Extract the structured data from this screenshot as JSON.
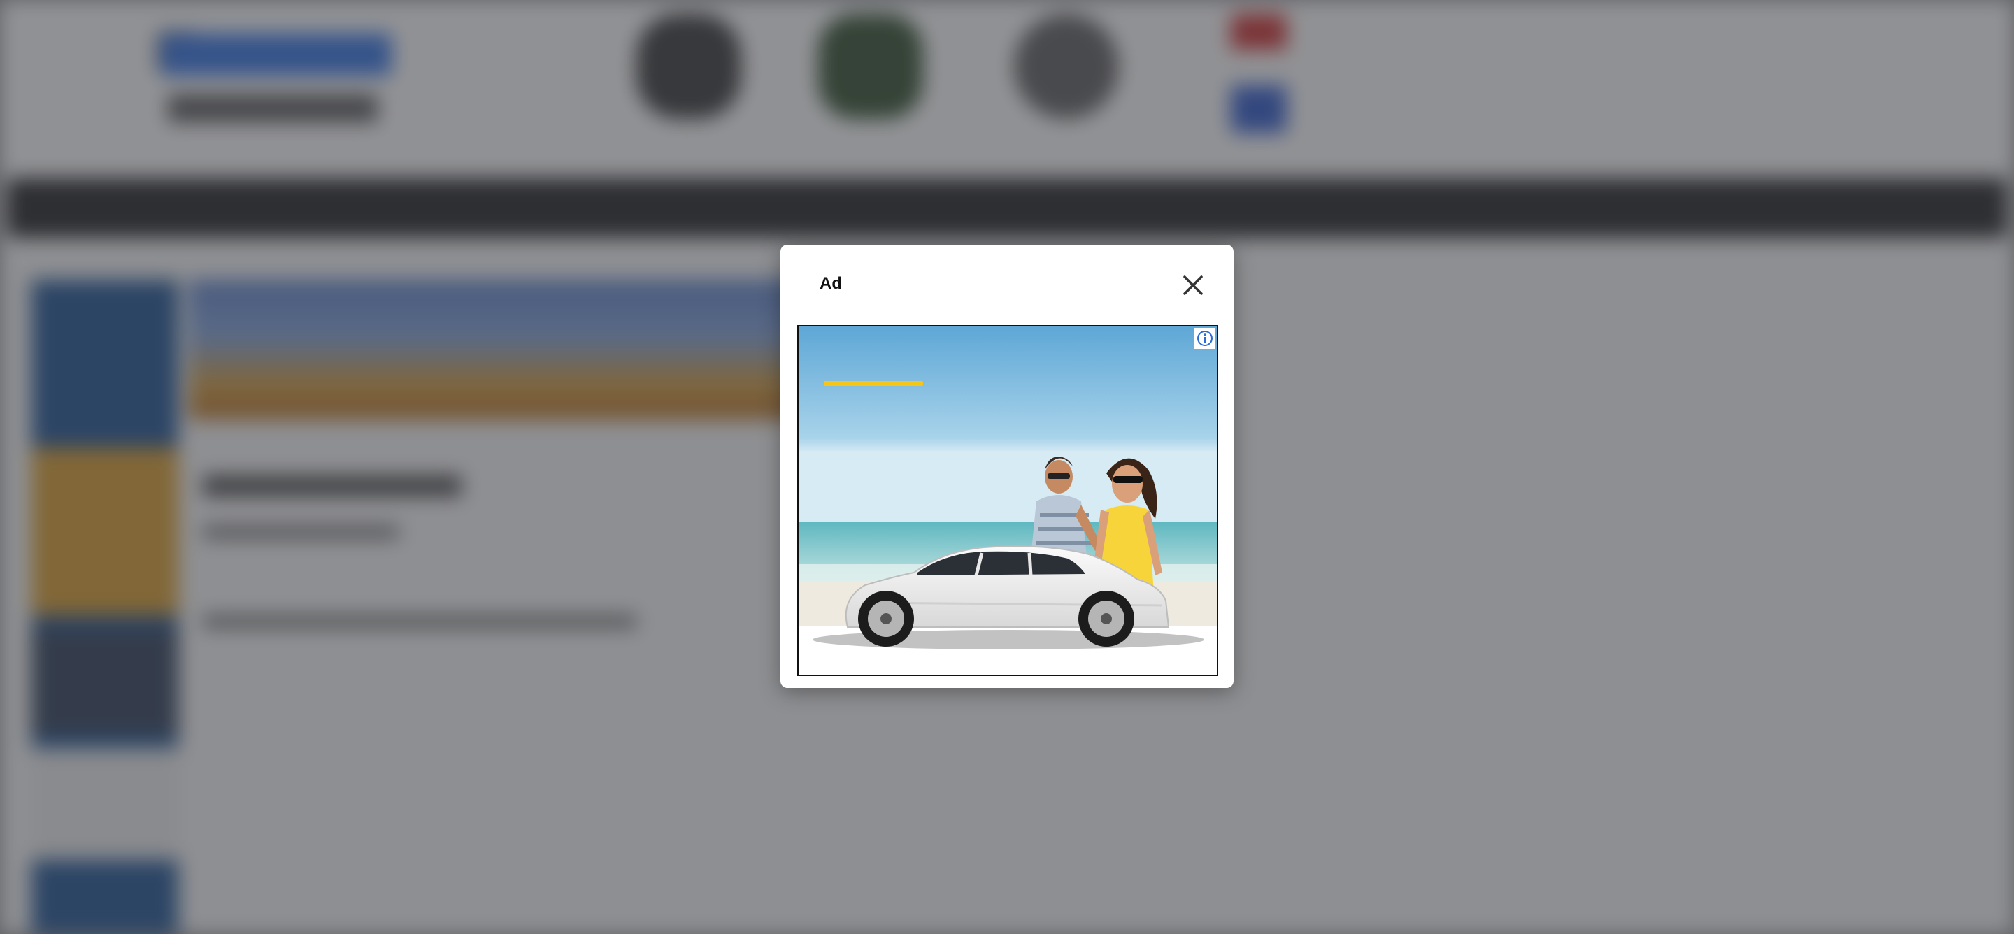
{
  "ad_modal": {
    "title": "Ad",
    "close_icon": "close-icon",
    "info_icon": "info-icon"
  },
  "colors": {
    "overlay": "#3c3e44",
    "modal_bg": "#ffffff",
    "ad_accent": "#f5c518",
    "nav_bg": "#1d1e20",
    "sidebar_bg": "#1b4f8f"
  }
}
